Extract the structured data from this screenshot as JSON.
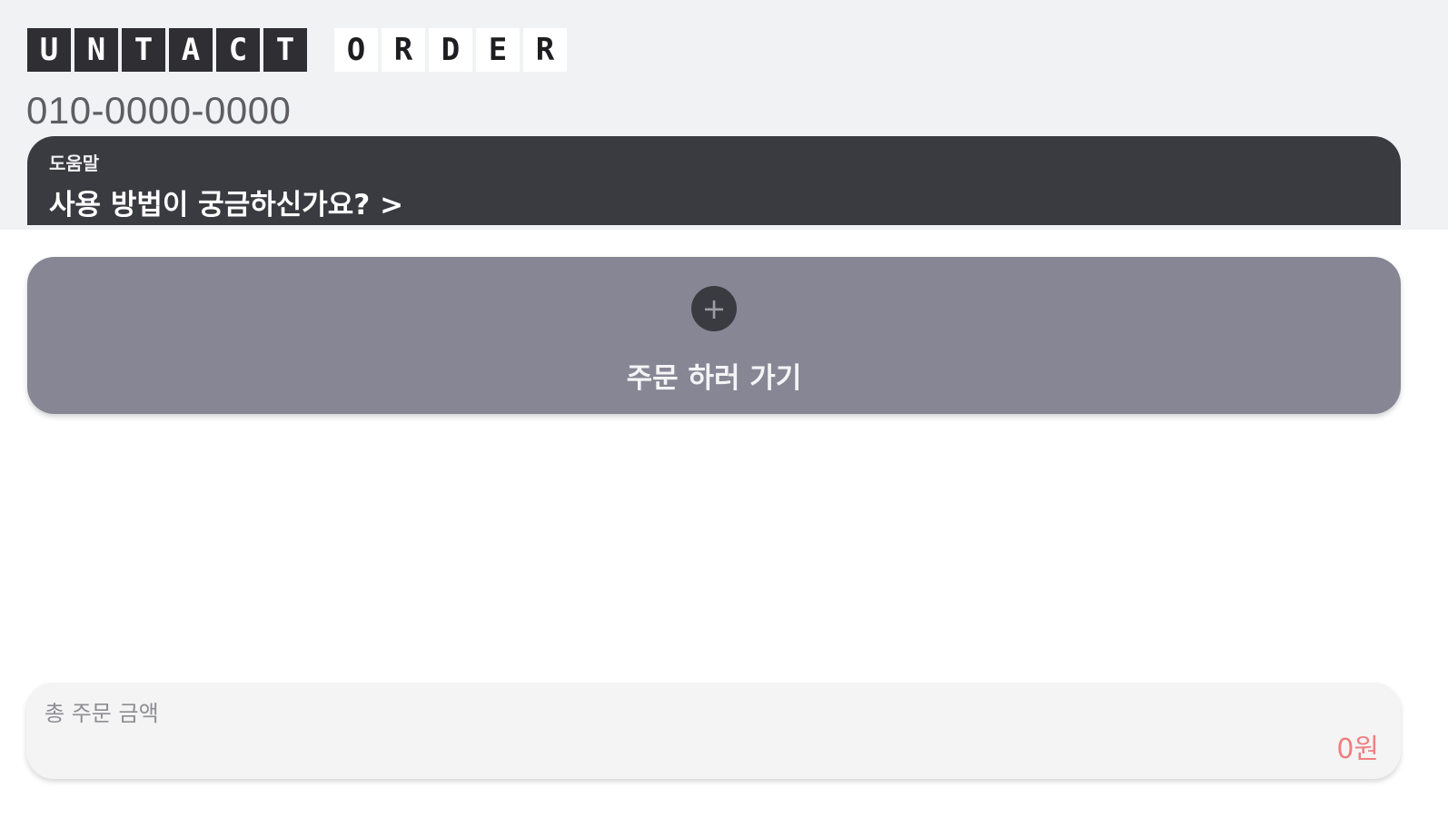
{
  "logo": {
    "word1": [
      "U",
      "N",
      "T",
      "A",
      "C",
      "T"
    ],
    "word2": [
      "O",
      "R",
      "D",
      "E",
      "R"
    ]
  },
  "phone": "010-0000-0000",
  "help": {
    "label": "도움말",
    "title": "사용 방법이 궁금하신가요? >"
  },
  "order": {
    "plus_glyph": "+",
    "label": "주문 하러 가기"
  },
  "total": {
    "label": "총 주문 금액",
    "value": "0원"
  },
  "colors": {
    "top_background": "#f1f2f4",
    "help_card": "#3a3a41",
    "order_card": "#878694",
    "total_card": "#f4f4f5",
    "total_value": "#f07f7f"
  }
}
